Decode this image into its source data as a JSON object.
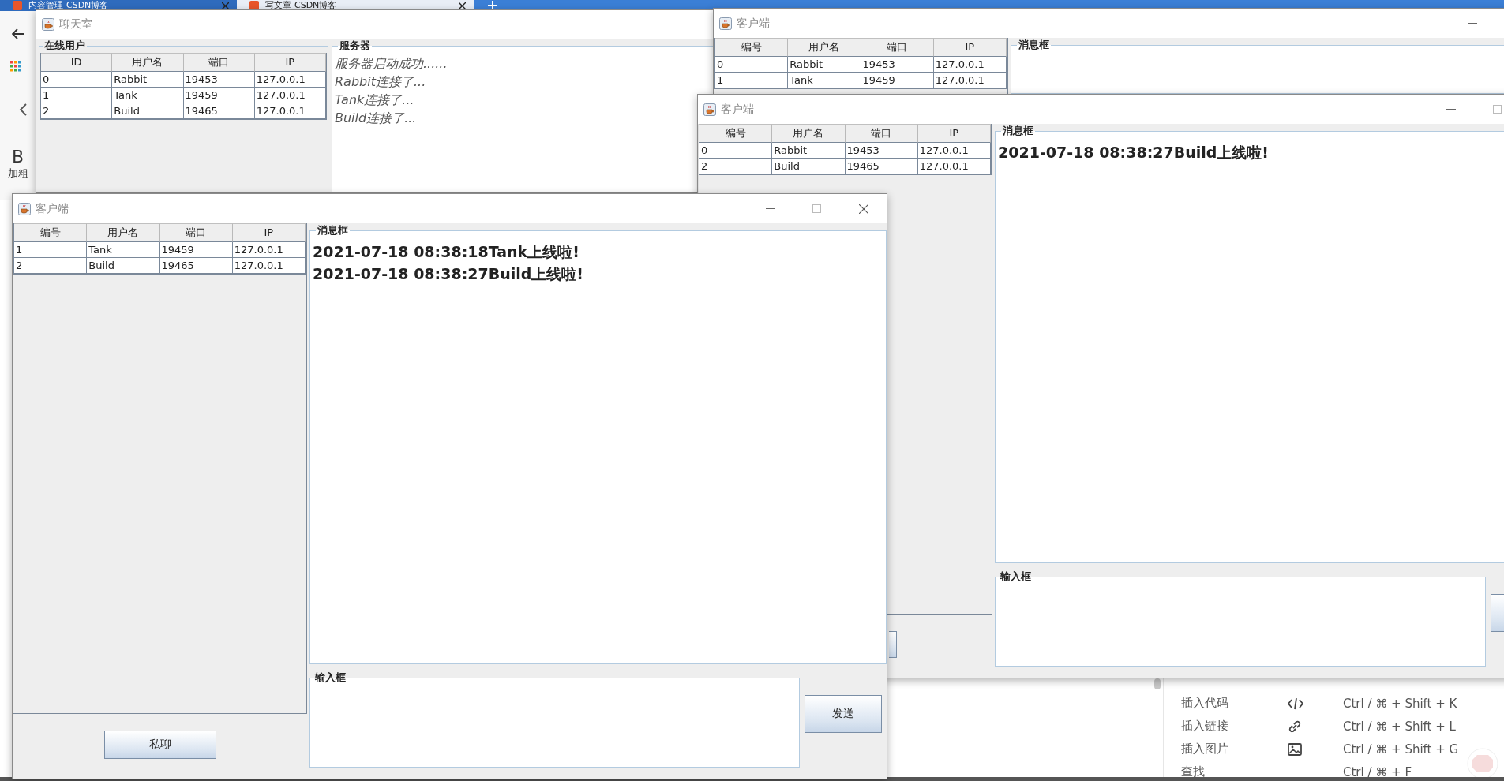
{
  "browser": {
    "tabs": [
      {
        "label": "内容管理-CSDN博客",
        "selected": false
      },
      {
        "label": "写文章-CSDN博客",
        "selected": true
      }
    ],
    "toolbar": [
      {
        "glyph": "B",
        "label": "加粗"
      }
    ],
    "shortcuts": [
      {
        "label": "插入代码",
        "kind": "code",
        "keys": "Ctrl / ⌘ + Shift + K"
      },
      {
        "label": "插入链接",
        "kind": "link",
        "keys": "Ctrl / ⌘ + Shift + L"
      },
      {
        "label": "插入图片",
        "kind": "image",
        "keys": "Ctrl / ⌘ + Shift + G"
      },
      {
        "label": "查找",
        "keys": "Ctrl / ⌘ + F"
      }
    ]
  },
  "server_window": {
    "title": "聊天室",
    "users_panel": {
      "title": "在线用户",
      "columns": [
        "ID",
        "用户名",
        "端口",
        "IP"
      ],
      "rows": [
        [
          "0",
          "Rabbit",
          "19453",
          "127.0.0.1"
        ],
        [
          "1",
          "Tank",
          "19459",
          "127.0.0.1"
        ],
        [
          "2",
          "Build",
          "19465",
          "127.0.0.1"
        ]
      ]
    },
    "server_panel": {
      "title": "服务器",
      "lines": [
        "服务器启动成功......",
        "Rabbit连接了...",
        "Tank连接了...",
        "Build连接了..."
      ]
    }
  },
  "client_windows": [
    {
      "title": "客户端",
      "title_buttons": [
        {
          "kind": "minimize"
        }
      ],
      "columns": [
        "编号",
        "用户名",
        "端口",
        "IP"
      ],
      "rows": [
        [
          "0",
          "Rabbit",
          "19453",
          "127.0.0.1"
        ],
        [
          "1",
          "Tank",
          "19459",
          "127.0.0.1"
        ]
      ],
      "message_panel": {
        "title": "消息框"
      }
    },
    {
      "title": "客户端",
      "title_buttons": [
        {
          "kind": "minimize"
        },
        {
          "kind": "maximize"
        }
      ],
      "columns": [
        "编号",
        "用户名",
        "端口",
        "IP"
      ],
      "rows": [
        [
          "0",
          "Rabbit",
          "19453",
          "127.0.0.1"
        ],
        [
          "2",
          "Build",
          "19465",
          "127.0.0.1"
        ]
      ],
      "message_panel": {
        "title": "消息框",
        "messages": [
          "2021-07-18 08:38:27Build上线啦!"
        ]
      },
      "input_panel": {
        "title": "输入框"
      },
      "controls": [
        {
          "kind": "private"
        },
        {
          "kind": "send"
        }
      ]
    },
    {
      "title": "客户端",
      "title_buttons": [
        {
          "kind": "minimize"
        },
        {
          "kind": "maximize"
        },
        {
          "kind": "close"
        }
      ],
      "columns": [
        "编号",
        "用户名",
        "端口",
        "IP"
      ],
      "rows": [
        [
          "1",
          "Tank",
          "19459",
          "127.0.0.1"
        ],
        [
          "2",
          "Build",
          "19465",
          "127.0.0.1"
        ]
      ],
      "message_panel": {
        "title": "消息框",
        "messages": [
          "2021-07-18 08:38:18Tank上线啦!",
          "2021-07-18 08:38:27Build上线啦!"
        ]
      },
      "input_panel": {
        "title": "输入框"
      },
      "controls": [
        {
          "kind": "private",
          "label": "私聊"
        },
        {
          "kind": "send",
          "label": "发送"
        }
      ]
    }
  ]
}
